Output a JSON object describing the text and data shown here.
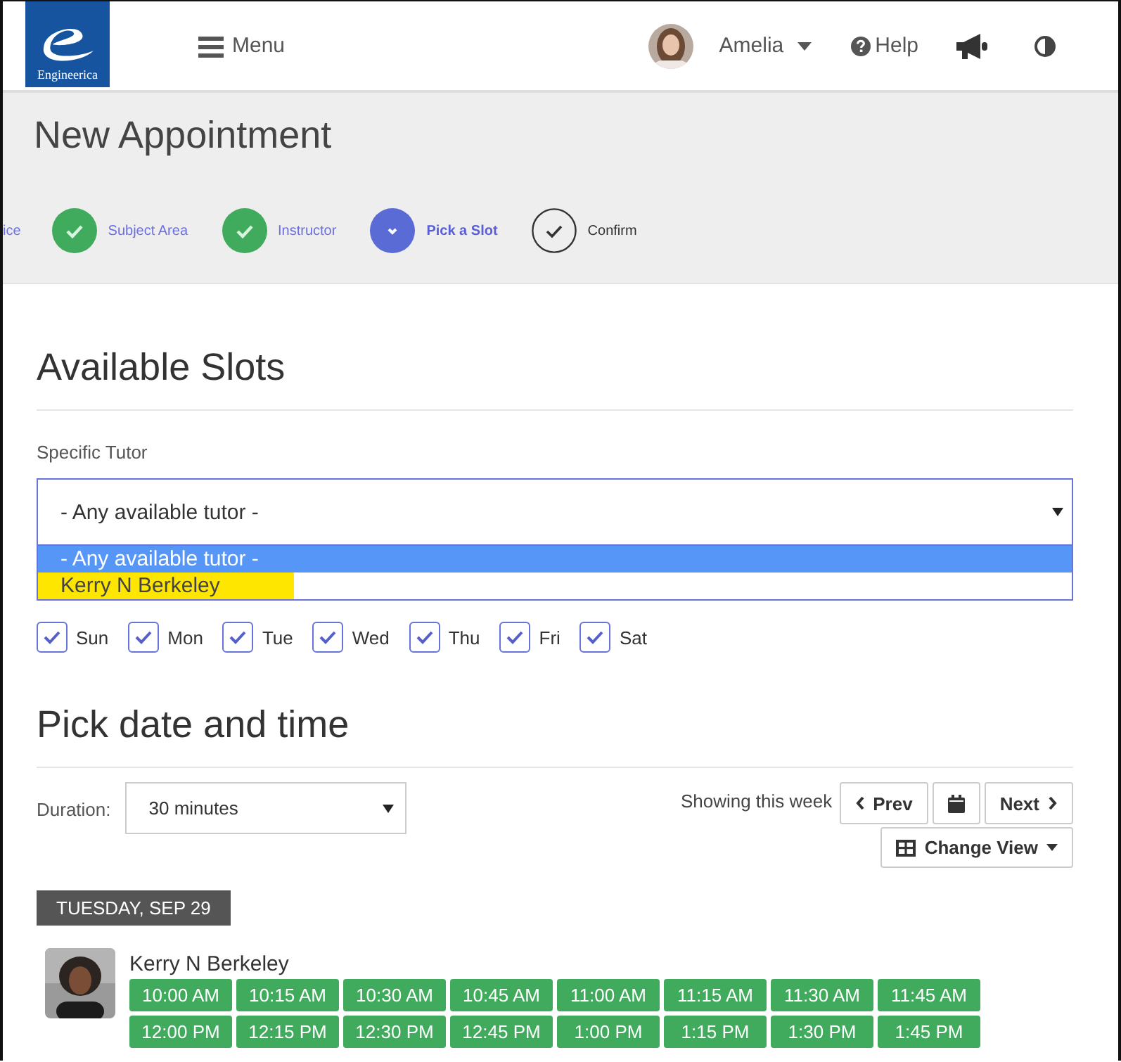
{
  "header": {
    "logo_text": "Engineerica",
    "menu_label": "Menu",
    "user": {
      "name": "Amelia"
    },
    "help_label": "Help"
  },
  "page_title": "New Appointment",
  "steps": [
    {
      "label": "ice",
      "kind": "partial"
    },
    {
      "label": "Subject Area",
      "kind": "done"
    },
    {
      "label": "Instructor",
      "kind": "done"
    },
    {
      "label": "Pick a Slot",
      "kind": "current"
    },
    {
      "label": "Confirm",
      "kind": "pending"
    }
  ],
  "available_slots": {
    "heading": "Available Slots",
    "tutor_label": "Specific Tutor",
    "tutor_value": "- Any available tutor -",
    "tutor_options": [
      {
        "label": "- Any available tutor -",
        "selected": true,
        "highlighted": false
      },
      {
        "label": "Kerry N Berkeley",
        "selected": false,
        "highlighted": true
      }
    ],
    "days": [
      {
        "label": "Sun",
        "checked": true
      },
      {
        "label": "Mon",
        "checked": true
      },
      {
        "label": "Tue",
        "checked": true
      },
      {
        "label": "Wed",
        "checked": true
      },
      {
        "label": "Thu",
        "checked": true
      },
      {
        "label": "Fri",
        "checked": true
      },
      {
        "label": "Sat",
        "checked": true
      }
    ]
  },
  "pick": {
    "heading": "Pick date and time",
    "duration_label": "Duration:",
    "duration_value": "30 minutes",
    "week_text": "Showing this week",
    "prev_label": "Prev",
    "next_label": "Next",
    "view_label": "Change View"
  },
  "day": {
    "date": "TUESDAY, SEP 29",
    "tutors": [
      {
        "name": "Kerry N Berkeley",
        "slots": [
          "10:00 AM",
          "10:15 AM",
          "10:30 AM",
          "10:45 AM",
          "11:00 AM",
          "11:15 AM",
          "11:30 AM",
          "11:45 AM",
          "12:00 PM",
          "12:15 PM",
          "12:30 PM",
          "12:45 PM",
          "1:00 PM",
          "1:15 PM",
          "1:30 PM",
          "1:45 PM"
        ]
      }
    ]
  }
}
